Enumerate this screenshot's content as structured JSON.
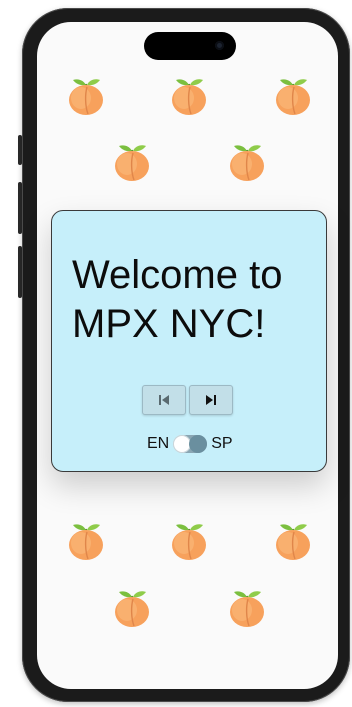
{
  "welcome": {
    "title": "Welcome to\nMPX NYC!"
  },
  "controls": {
    "prev_icon": "skip-previous-icon",
    "next_icon": "play-next-icon"
  },
  "language": {
    "left_label": "EN",
    "right_label": "SP",
    "selected": "SP"
  },
  "decor": {
    "icon": "peach-icon",
    "count": 10
  },
  "colors": {
    "card_background": "#c6effa",
    "screen_background": "#fafafa",
    "peach": "#f7a15c",
    "leaf": "#7bbf3f"
  }
}
